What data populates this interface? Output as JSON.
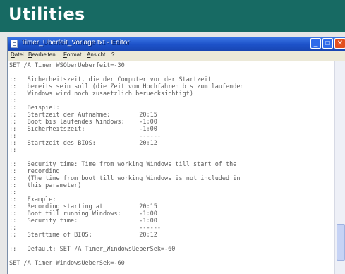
{
  "banner": {
    "title": "Utilities"
  },
  "window": {
    "title": "Timer_Uberfeit_Vorlage.txt - Editor",
    "controls": {
      "minimize": "_",
      "maximize": "□",
      "close": "✕"
    }
  },
  "menubar": {
    "items": [
      "Datei",
      "Bearbeiten",
      "Format",
      "Ansicht",
      "?"
    ]
  },
  "lines": [
    "SET /A Timer_WSOberUeberfeit=-30",
    "",
    "::   Sicherheitszeit, die der Computer vor der Startzeit",
    "::   bereits sein soll (die Zeit vom Hochfahren bis zum laufenden",
    "::   Windows wird noch zusaetzlich beruecksichtigt)",
    "::",
    "::   Beispiel:",
    "::   Startzeit der Aufnahme:        20:15",
    "::   Boot bis laufendes Windows:    -1:00",
    "::   Sicherheitszeit:               -1:00",
    "::                                  ------",
    "::   Startzeit des BIOS:            20:12",
    "::",
    "",
    "::   Security time: Time from working Windows till start of the",
    "::   recording",
    "::   (The time from boot till working Windows is not included in",
    "::   this parameter)",
    "::",
    "::   Example:",
    "::   Recording starting at          20:15",
    "::   Boot till running Windows:     -1:00",
    "::   Security time:                 -1:00",
    "::                                  ------",
    "::   Starttime of BIOS:             20:12",
    "",
    "::   Default: SET /A Timer_WindowsUeberSek=-60",
    "",
    "SET /A Timer_WindowsUeberSek=-60"
  ]
}
